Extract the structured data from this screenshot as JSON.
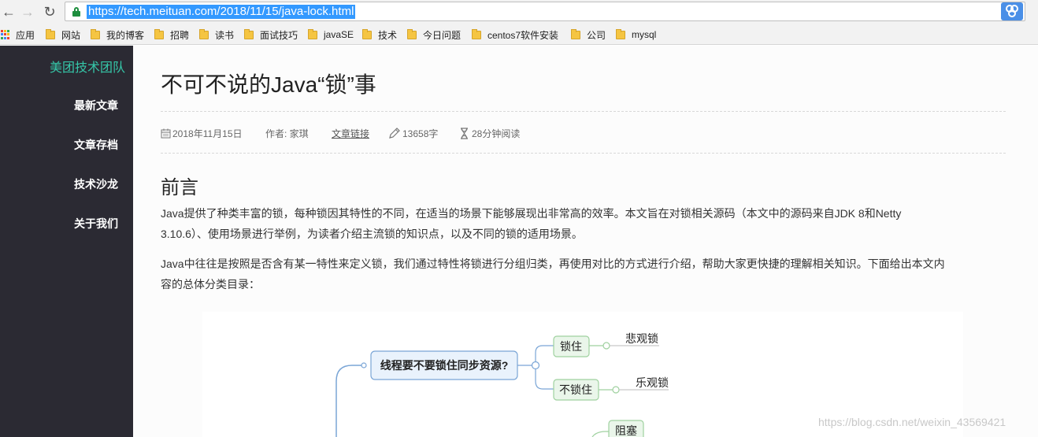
{
  "browser": {
    "url": "https://tech.meituan.com/2018/11/15/java-lock.html",
    "bookmarks": [
      {
        "label": "应用",
        "icon": "apps-icon"
      },
      {
        "label": "网站",
        "icon": "folder-icon"
      },
      {
        "label": "我的博客",
        "icon": "folder-icon"
      },
      {
        "label": "招聘",
        "icon": "folder-icon"
      },
      {
        "label": "读书",
        "icon": "folder-icon"
      },
      {
        "label": "面试技巧",
        "icon": "folder-icon"
      },
      {
        "label": "javaSE",
        "icon": "folder-icon"
      },
      {
        "label": "技术",
        "icon": "folder-icon"
      },
      {
        "label": "今日问题",
        "icon": "folder-icon"
      },
      {
        "label": "centos7软件安装",
        "icon": "folder-icon"
      },
      {
        "label": "公司",
        "icon": "folder-icon"
      },
      {
        "label": "mysql",
        "icon": "folder-icon"
      }
    ]
  },
  "sidebar": {
    "brand": "美团技术团队",
    "items": [
      {
        "label": "最新文章"
      },
      {
        "label": "文章存档"
      },
      {
        "label": "技术沙龙"
      },
      {
        "label": "关于我们"
      }
    ]
  },
  "article": {
    "title": "不可不说的Java“锁”事",
    "meta": {
      "date": "2018年11月15日",
      "author": "作者: 家琪",
      "link": "文章链接",
      "words": "13658字",
      "read_time": "28分钟阅读"
    },
    "section_title": "前言",
    "paragraphs": [
      [
        "Java提供了种类丰富的锁，每种锁因其特性的不同，在适当的场景下能够展现出非常高的效率。本文旨在对锁相关源码（本文中的源码来自JDK 8和Netty",
        "3.10.6）、使用场景进行举例，为读者介绍主流锁的知识点，以及不同的锁的适用场景。"
      ],
      [
        "Java中往往是按照是否含有某一特性来定义锁，我们通过特性将锁进行分组归类，再使用对比的方式进行介绍，帮助大家更快捷的理解相关知识。下面给出本文内",
        "容的总体分类目录："
      ]
    ],
    "mindmap": {
      "root": "线程要不要锁住同步资源?",
      "branches": [
        {
          "label": "锁住",
          "leaf": "悲观锁"
        },
        {
          "label": "不锁住",
          "leaf": "乐观锁"
        }
      ],
      "partial_node": "阻塞"
    },
    "watermark": "https://blog.csdn.net/weixin_43569421"
  }
}
